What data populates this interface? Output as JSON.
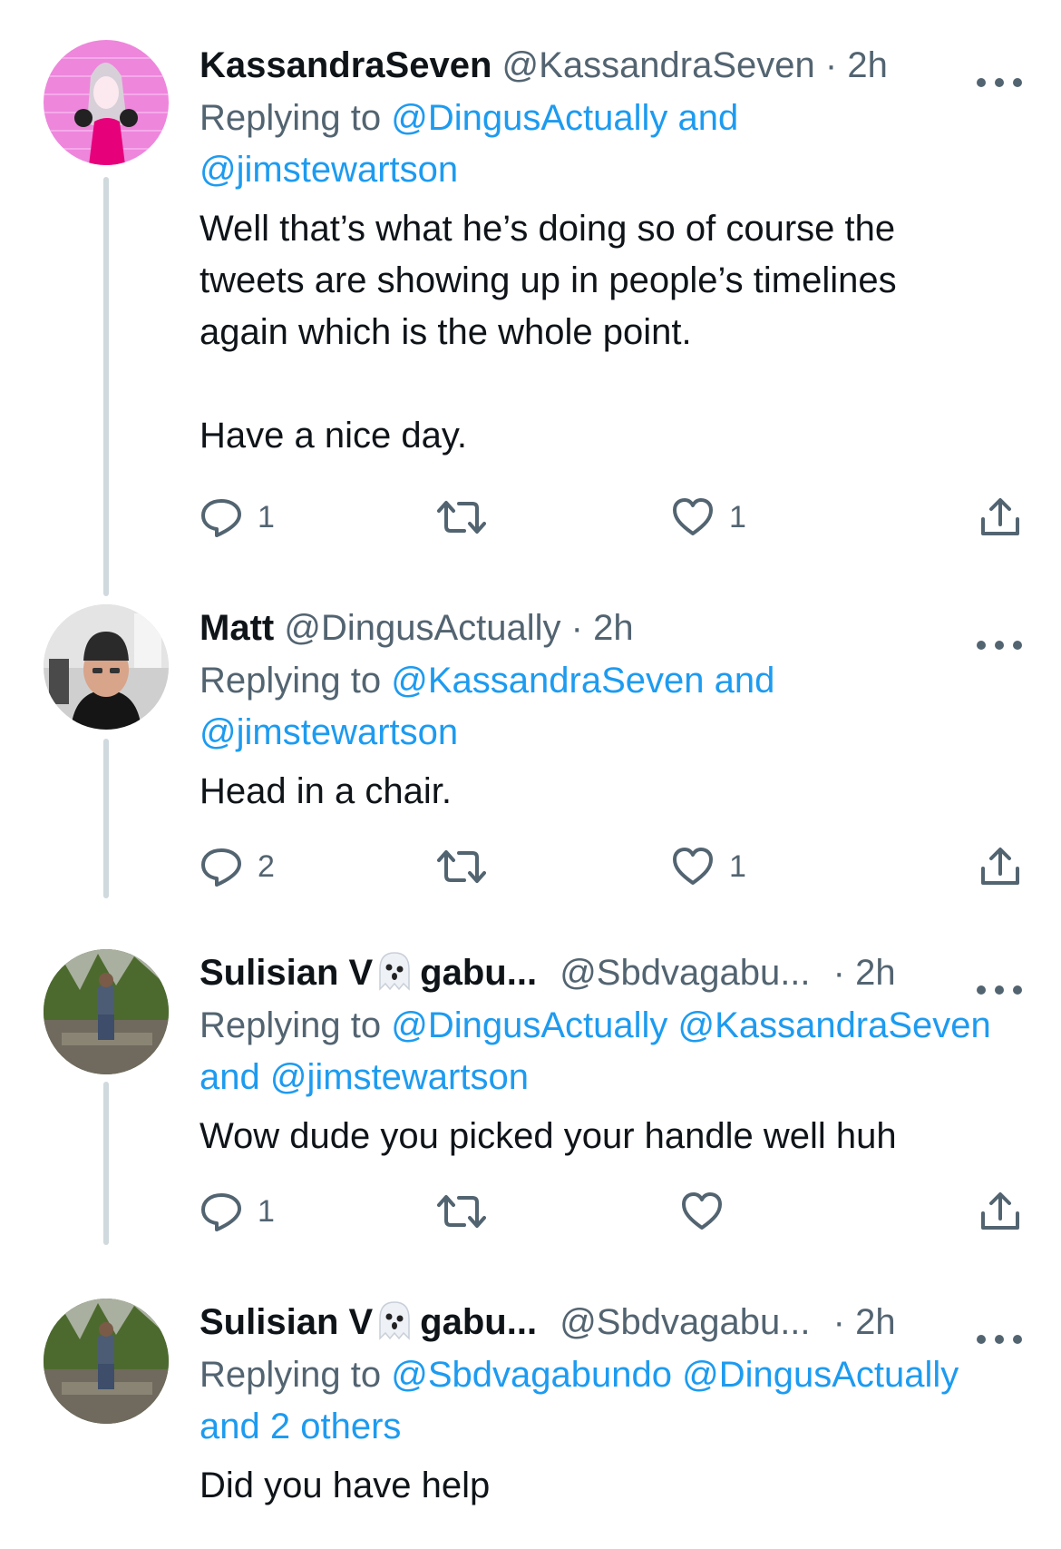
{
  "tweets": [
    {
      "display_name": "KassandraSeven",
      "handle": "@KassandraSeven",
      "separator": "·",
      "time": "2h",
      "replying_label": "Replying to",
      "reply_mentions_line1": "@DingusActually and",
      "reply_mentions_line2": "@jimstewartson",
      "text": "Well that’s what he’s doing so of course the\ntweets are showing up in people’s timelines\nagain which is the whole point.\n\nHave a nice day.",
      "reply_count": "1",
      "retweet_count": "",
      "like_count": "1",
      "avatar": "pink-anime-avatar"
    },
    {
      "display_name": "Matt",
      "handle": "@DingusActually",
      "separator": "·",
      "time": "2h",
      "replying_label": "Replying to",
      "reply_mentions_line1": "@KassandraSeven and",
      "reply_mentions_line2": "@jimstewartson",
      "text": "Head in a chair.",
      "reply_count": "2",
      "retweet_count": "",
      "like_count": "1",
      "avatar": "man-beanie-photo"
    },
    {
      "display_name_part1": "Sulisian V",
      "display_name_part2": "gabu...",
      "name_emoji": "ghost-emoji",
      "handle": "@Sbdvagabu...",
      "separator": "·",
      "time": "2h",
      "replying_label": "Replying to",
      "reply_mentions_line1": "@DingusActually @KassandraSeven",
      "reply_mentions_line2": "and @jimstewartson",
      "text": "Wow dude you picked your handle well huh",
      "reply_count": "1",
      "retweet_count": "",
      "like_count": "",
      "avatar": "outdoor-person-photo"
    },
    {
      "display_name_part1": "Sulisian V",
      "display_name_part2": "gabu...",
      "name_emoji": "ghost-emoji",
      "handle": "@Sbdvagabu...",
      "separator": "·",
      "time": "2h",
      "replying_label": "Replying to",
      "reply_mentions_line1": "@Sbdvagabundo @DingusActually",
      "reply_mentions_line2": "and 2 others",
      "text": "Did you have help",
      "avatar": "outdoor-person-photo"
    }
  ],
  "colors": {
    "text_primary": "#0f1419",
    "text_secondary": "#536471",
    "link_blue": "#1d9bf0",
    "thread_line": "#cfd9de"
  }
}
